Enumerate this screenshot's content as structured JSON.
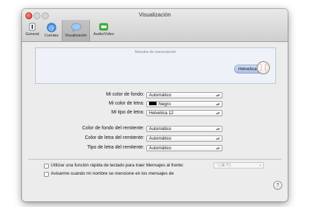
{
  "window": {
    "title": "Visualización"
  },
  "toolbar": {
    "items": [
      {
        "label": "General",
        "icon": "general-switch-icon"
      },
      {
        "label": "Cuentas",
        "icon": "at-sign-icon"
      },
      {
        "label": "Visualización",
        "icon": "speech-bubble-icon",
        "selected": true
      },
      {
        "label": "Audio/Vídeo",
        "icon": "video-camera-icon"
      }
    ]
  },
  "preview": {
    "title": "Muestra de transcripción",
    "bubble_text": "Helvetica 12"
  },
  "settings": [
    {
      "label": "Mi color de fondo:",
      "value": "Automático"
    },
    {
      "label": "Mi color de letra:",
      "value": "Negro",
      "swatch": "#000000"
    },
    {
      "label": "Mi tipo de letra:",
      "value": "Helvetica 12"
    },
    {
      "label": "Color de fondo del remitente:",
      "value": "Automático"
    },
    {
      "label": "Color de letra del remitente:",
      "value": "Automático"
    },
    {
      "label": "Tipo de letra del remitente:",
      "value": "Automático"
    }
  ],
  "options": {
    "shortcut_label": "Utilizar una función rápida de teclado para traer Mensajes al frente:",
    "shortcut_value": "⌥⌘ F1",
    "notify_label": "Avisarme cuando mi nombre se mencione en los mensajes de"
  },
  "help": {
    "label": "?"
  },
  "colors": {
    "bubble": "#b5c7ee",
    "close": "#e0443a"
  }
}
